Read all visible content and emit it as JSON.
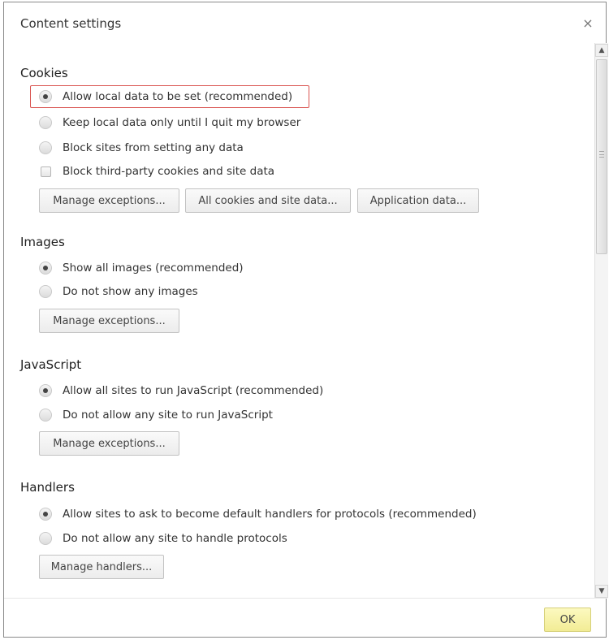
{
  "dialog": {
    "title": "Content settings",
    "close_icon": "close-icon"
  },
  "cookies": {
    "title": "Cookies",
    "options": [
      {
        "label": "Allow local data to be set (recommended)",
        "selected": true
      },
      {
        "label": "Keep local data only until I quit my browser",
        "selected": false
      },
      {
        "label": "Block sites from setting any data",
        "selected": false
      }
    ],
    "checkbox": {
      "label": "Block third-party cookies and site data",
      "checked": false
    },
    "buttons": [
      "Manage exceptions...",
      "All cookies and site data...",
      "Application data..."
    ]
  },
  "images": {
    "title": "Images",
    "options": [
      {
        "label": "Show all images (recommended)",
        "selected": true
      },
      {
        "label": "Do not show any images",
        "selected": false
      }
    ],
    "button": "Manage exceptions..."
  },
  "javascript": {
    "title": "JavaScript",
    "options": [
      {
        "label": "Allow all sites to run JavaScript (recommended)",
        "selected": true
      },
      {
        "label": "Do not allow any site to run JavaScript",
        "selected": false
      }
    ],
    "button": "Manage exceptions..."
  },
  "handlers": {
    "title": "Handlers",
    "options": [
      {
        "label": "Allow sites to ask to become default handlers for protocols (recommended)",
        "selected": true
      },
      {
        "label": "Do not allow any site to handle protocols",
        "selected": false
      }
    ],
    "button": "Manage handlers..."
  },
  "footer": {
    "ok_label": "OK"
  },
  "colors": {
    "highlight": "#d9534f",
    "ok_button": "#f5f0a8"
  }
}
